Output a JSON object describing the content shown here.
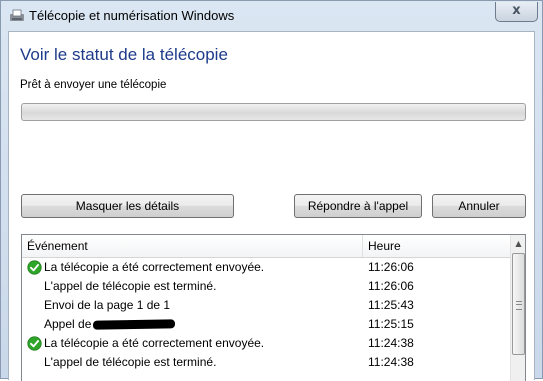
{
  "window": {
    "title": "Télécopie et numérisation Windows",
    "close_glyph": "x"
  },
  "heading": "Voir le statut de la télécopie",
  "status_text": "Prêt à envoyer une télécopie",
  "progress": {
    "value_percent": 0
  },
  "buttons": {
    "hide_details": "Masquer les détails",
    "answer_call": "Répondre à l'appel",
    "cancel": "Annuler"
  },
  "events": {
    "columns": {
      "event": "Événement",
      "time": "Heure"
    },
    "rows": [
      {
        "icon": "success-check-icon",
        "event": "La télécopie a été correctement envoyée.",
        "time": "11:26:06"
      },
      {
        "icon": "",
        "event": "L'appel de télécopie est terminé.",
        "time": "11:26:06"
      },
      {
        "icon": "",
        "event": "Envoi de la page 1 de 1",
        "time": "11:25:43"
      },
      {
        "icon": "",
        "event": "Appel de",
        "time": "11:25:15",
        "redacted": true
      },
      {
        "icon": "success-check-icon",
        "event": "La télécopie a été correctement envoyée.",
        "time": "11:24:38"
      },
      {
        "icon": "",
        "event": "L'appel de télécopie est terminé.",
        "time": "11:24:38"
      }
    ]
  },
  "colors": {
    "heading": "#1e3b8a",
    "success": "#2fa52a"
  }
}
